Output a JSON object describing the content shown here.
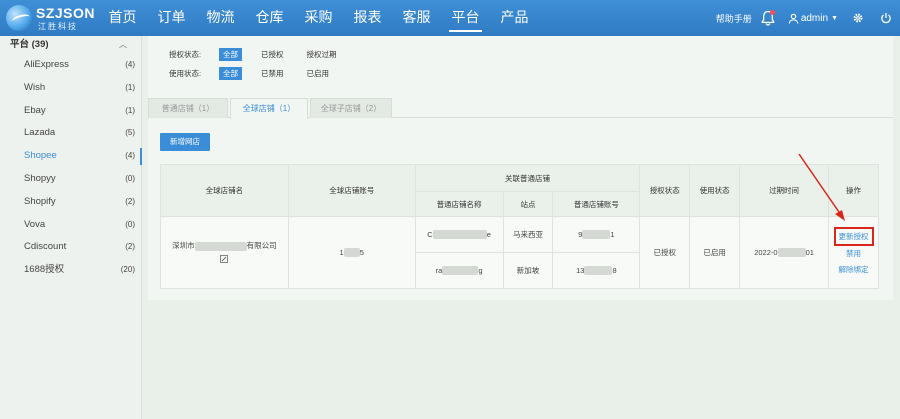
{
  "brand": {
    "name": "SZJSON",
    "subtitle": "江胜科技"
  },
  "nav": {
    "items": [
      "首页",
      "订单",
      "物流",
      "仓库",
      "采购",
      "报表",
      "客服",
      "平台",
      "产品"
    ],
    "active_index": 7
  },
  "topbar": {
    "help": "帮助手册",
    "user": "admin"
  },
  "sidebar": {
    "header": "平台 (39)",
    "items": [
      {
        "label": "AliExpress",
        "count": "(4)"
      },
      {
        "label": "Wish",
        "count": "(1)"
      },
      {
        "label": "Ebay",
        "count": "(1)"
      },
      {
        "label": "Lazada",
        "count": "(5)"
      },
      {
        "label": "Shopee",
        "count": "(4)"
      },
      {
        "label": "Shopyy",
        "count": "(0)"
      },
      {
        "label": "Shopify",
        "count": "(2)"
      },
      {
        "label": "Vova",
        "count": "(0)"
      },
      {
        "label": "Cdiscount",
        "count": "(2)"
      },
      {
        "label": "1688授权",
        "count": "(20)"
      }
    ],
    "active_index": 4
  },
  "filters": {
    "auth": {
      "label": "授权状态:",
      "options": [
        "全部",
        "已授权",
        "授权过期"
      ],
      "selected": 0
    },
    "usage": {
      "label": "使用状态:",
      "options": [
        "全部",
        "已禁用",
        "已启用"
      ],
      "selected": 0
    }
  },
  "tabs": [
    {
      "label": "普通店铺（1）"
    },
    {
      "label": "全球店铺（1）"
    },
    {
      "label": "全球子店铺（2）"
    }
  ],
  "active_tab": 1,
  "add_button": "新增网店",
  "table": {
    "headers": {
      "global_name": "全球店铺名",
      "global_account": "全球店铺账号",
      "linked": "关联普通店铺",
      "store_name": "普通店铺名称",
      "site": "站点",
      "store_account": "普通店铺账号",
      "auth_status": "授权状态",
      "use_status": "使用状态",
      "expire": "过期时间",
      "ops": "操作"
    },
    "row": {
      "global_name_prefix": "深圳市",
      "global_name_suffix": "有限公司",
      "account_prefix": "1",
      "account_suffix": "5",
      "auth_status": "已授权",
      "use_status": "已启用",
      "expire_prefix": "2022-0",
      "expire_suffix": "01",
      "ops": [
        "更新授权",
        "禁用",
        "解除绑定"
      ],
      "sub_stores": [
        {
          "name_prefix": "C",
          "name_suffix": "e",
          "site": "马来西亚",
          "acct_prefix": "9",
          "acct_suffix": "1"
        },
        {
          "name_prefix": "ra",
          "name_suffix": "g",
          "site": "新加坡",
          "acct_prefix": "13",
          "acct_suffix": "8"
        }
      ]
    }
  },
  "colors": {
    "primary": "#3b8dd8",
    "highlight": "#d9261c",
    "nav_bg": "#2f7bc4"
  }
}
